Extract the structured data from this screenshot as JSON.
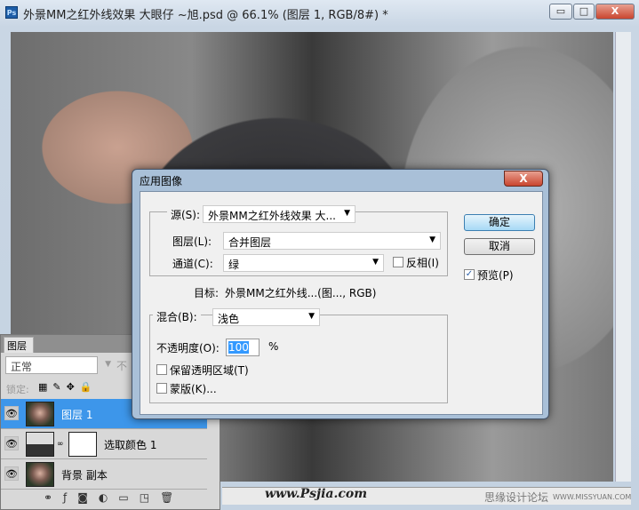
{
  "window": {
    "title": "外景MM之红外线效果 大眼仔 ~旭.psd @ 66.1% (图层 1, RGB/8#) *",
    "app_icon": "Ps",
    "min": "▭",
    "max": "□",
    "close": "X"
  },
  "watermarks": {
    "site": "www.Psjia.com",
    "forum": "思缘设计论坛",
    "forum_url": "WWW.MISSYUAN.COM"
  },
  "layers_panel": {
    "tab": "图层",
    "blend_mode": "正常",
    "opacity_label_partial": "不",
    "lock_label": "锁定:",
    "layers": [
      {
        "name": "图层 1",
        "selected": true
      },
      {
        "name": "选取颜色 1",
        "selected": false
      },
      {
        "name": "背景 副本",
        "selected": false
      }
    ]
  },
  "dialog": {
    "title": "应用图像",
    "close": "X",
    "source_label": "源(S):",
    "source_value": "外景MM之红外线效果 大...",
    "layer_label": "图层(L):",
    "layer_value": "合并图层",
    "channel_label": "通道(C):",
    "channel_value": "绿",
    "invert_label": "反相(I)",
    "invert_checked": false,
    "target_label": "目标:",
    "target_value": "外景MM之红外线...(图..., RGB)",
    "blend_label": "混合(B):",
    "blend_value": "浅色",
    "opacity_label": "不透明度(O):",
    "opacity_value": "100",
    "opacity_unit": "%",
    "preserve_label": "保留透明区域(T)",
    "preserve_checked": false,
    "mask_label": "蒙版(K)...",
    "mask_checked": false,
    "ok": "确定",
    "cancel": "取消",
    "preview_label": "预览(P)",
    "preview_checked": true
  }
}
